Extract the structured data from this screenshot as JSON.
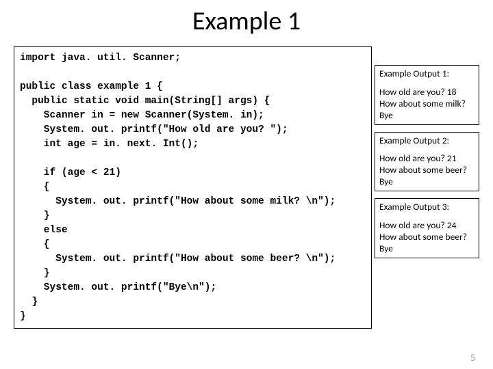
{
  "title": "Example 1",
  "code": "import java. util. Scanner;\n\npublic class example 1 {\n  public static void main(String[] args) {\n    Scanner in = new Scanner(System. in);\n    System. out. printf(\"How old are you? \");\n    int age = in. next. Int();\n\n    if (age < 21)\n    {\n      System. out. printf(\"How about some milk? \\n\");\n    }\n    else\n    {\n      System. out. printf(\"How about some beer? \\n\");\n    }\n    System. out. printf(\"Bye\\n\");\n  }\n}",
  "outputs": [
    {
      "header": "Example Output 1:",
      "lines": [
        "How old are you? 18",
        "How about some milk?",
        "Bye"
      ]
    },
    {
      "header": "Example Output 2:",
      "lines": [
        "How old are you? 21",
        "How about some beer?",
        "Bye"
      ]
    },
    {
      "header": "Example Output 3:",
      "lines": [
        "How old are you? 24",
        "How about some beer?",
        "Bye"
      ]
    }
  ],
  "page_number": "5"
}
